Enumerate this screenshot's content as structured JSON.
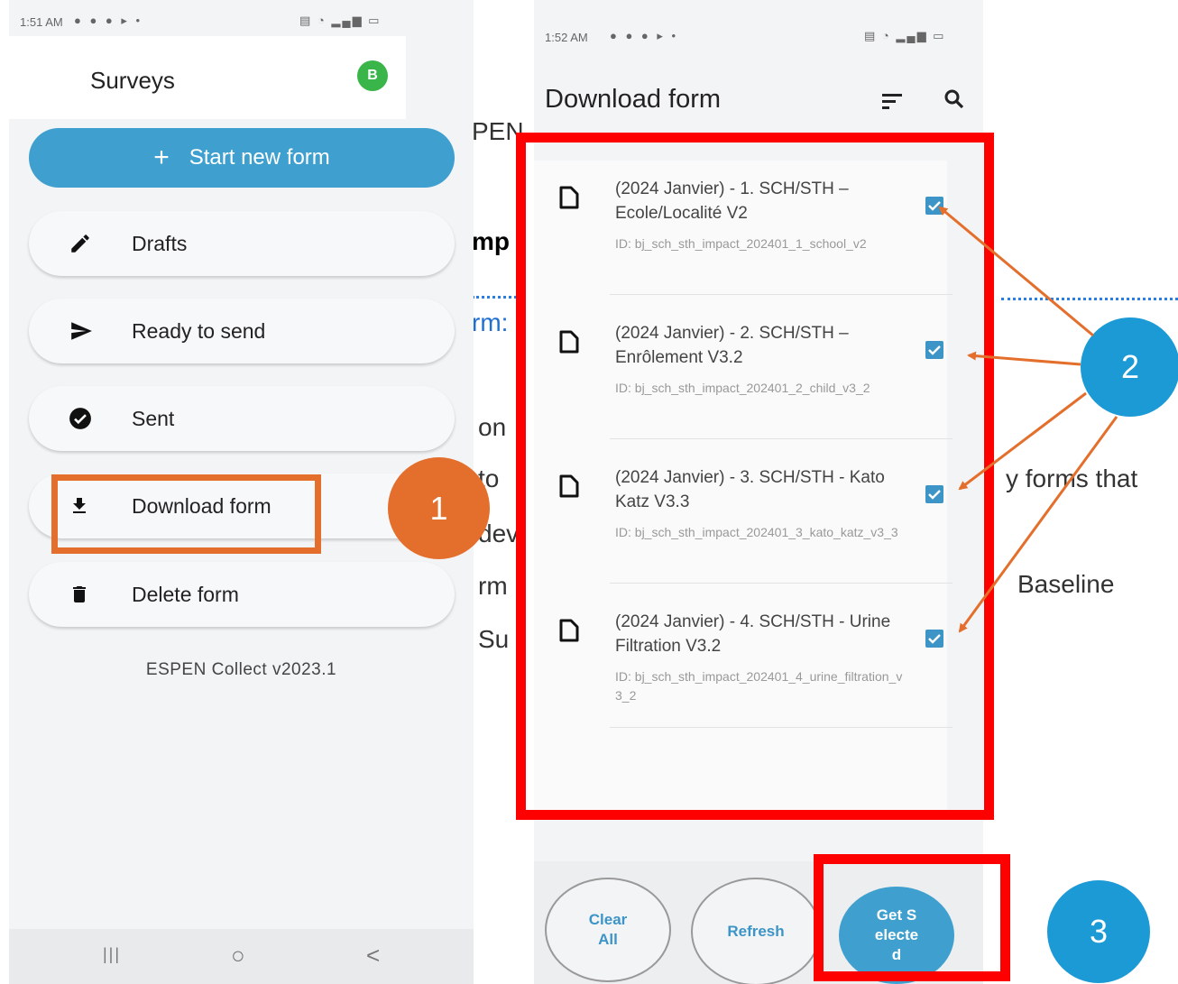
{
  "background_doc": {
    "frag_pen": "PEN",
    "frag_mp": "mp",
    "frag_rm": "rm:",
    "frag_on": "on",
    "frag_to": "to",
    "frag_dev": "dev",
    "frag_rm2": "rm",
    "frag_su": "Su",
    "frag_forms_that": "y forms that",
    "frag_baseline": "Baseline"
  },
  "left_phone": {
    "status_time": "1:51 AM",
    "header": {
      "title": "Surveys",
      "avatar_letter": "B"
    },
    "start_button": {
      "icon": "plus-icon",
      "label": "Start new form"
    },
    "menu": [
      {
        "icon": "pencil-icon",
        "label": "Drafts"
      },
      {
        "icon": "send-icon",
        "label": "Ready to send"
      },
      {
        "icon": "check-circle-icon",
        "label": "Sent"
      },
      {
        "icon": "download-icon",
        "label": "Download form"
      },
      {
        "icon": "trash-icon",
        "label": "Delete form"
      }
    ],
    "version": "ESPEN Collect v2023.1",
    "navbar": {
      "recent": "|||",
      "home": "○",
      "back": "<"
    }
  },
  "right_phone": {
    "status_time": "1:52 AM",
    "title": "Download form",
    "forms": [
      {
        "title": "(2024 Janvier) - 1. SCH/STH – Ecole/Localité V2",
        "id": "ID: bj_sch_sth_impact_202401_1_school_v2",
        "checked": true
      },
      {
        "title": "(2024 Janvier) - 2. SCH/STH – Enrôlement V3.2",
        "id": "ID: bj_sch_sth_impact_202401_2_child_v3_2",
        "checked": true
      },
      {
        "title": "(2024 Janvier) - 3. SCH/STH - Kato Katz V3.3",
        "id": "ID: bj_sch_sth_impact_202401_3_kato_katz_v3_3",
        "checked": true
      },
      {
        "title": "(2024 Janvier) - 4. SCH/STH - Urine Filtration V3.2",
        "id": "ID: bj_sch_sth_impact_202401_4_urine_filtration_v3_2",
        "checked": true
      }
    ],
    "buttons": {
      "clear_all": "Clear All",
      "refresh": "Refresh",
      "get_selected": "Get Selected"
    }
  },
  "annotations": {
    "badge1": "1",
    "badge2": "2",
    "badge3": "3",
    "colors": {
      "orange": "#e46f2c",
      "red": "#ff0000",
      "blue": "#1c9ad6"
    }
  }
}
